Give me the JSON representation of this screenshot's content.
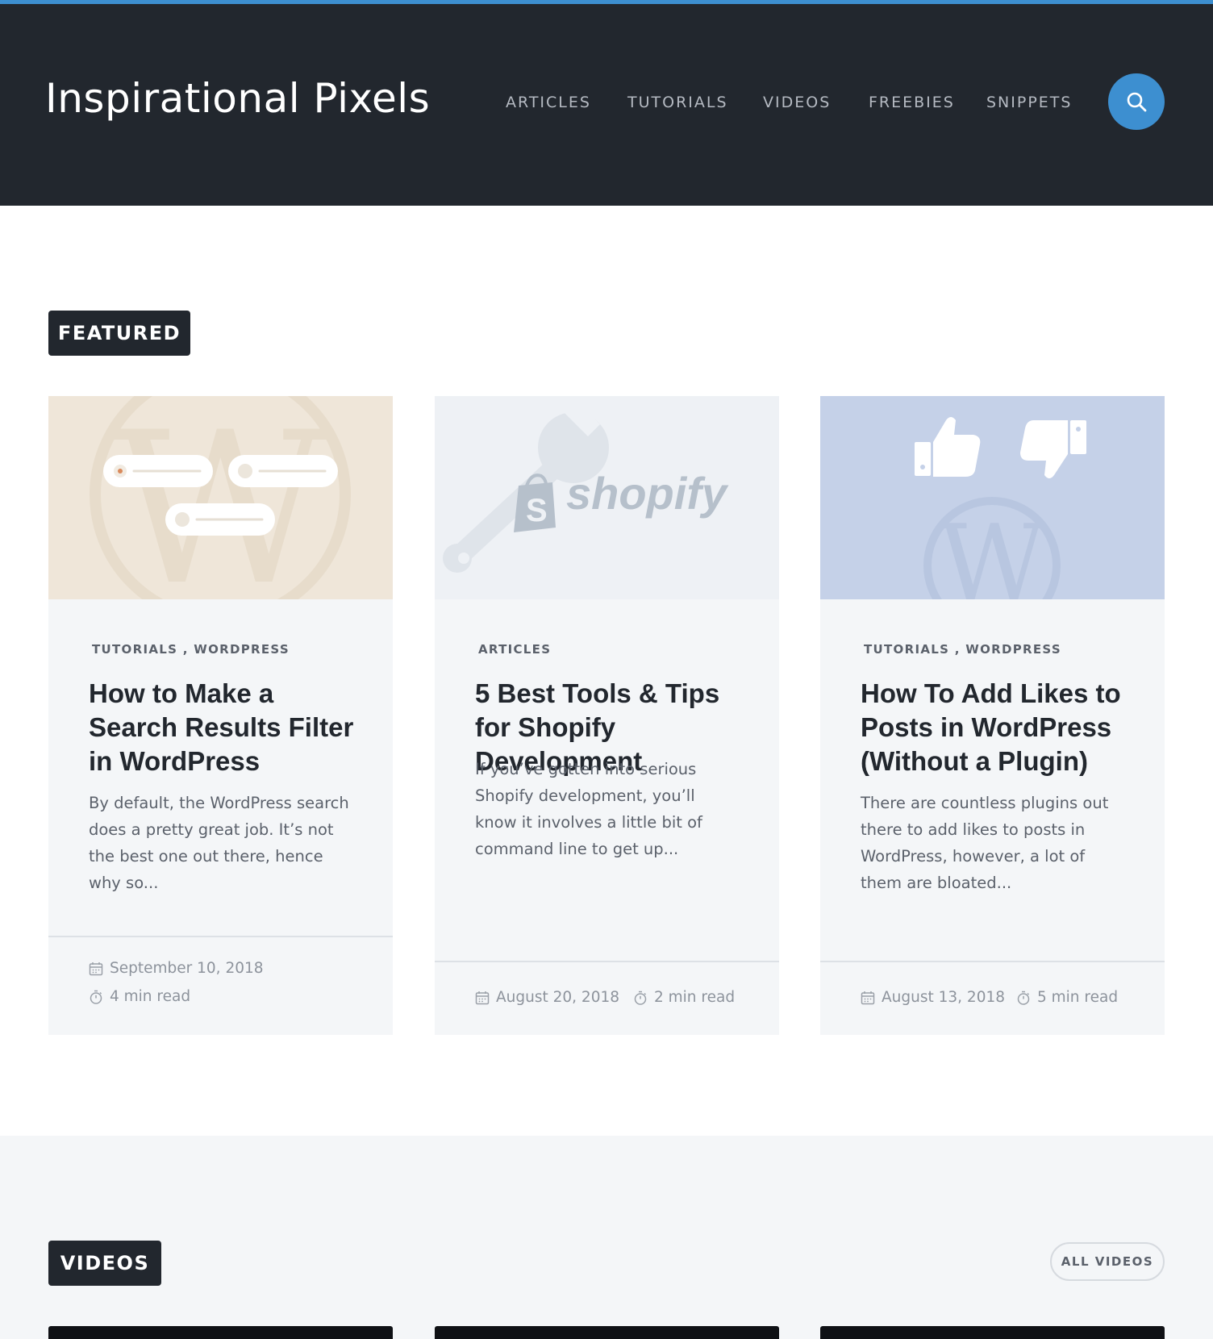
{
  "site": {
    "title": "Inspirational Pixels"
  },
  "nav": {
    "items": [
      {
        "label": "ARTICLES"
      },
      {
        "label": "TUTORIALS"
      },
      {
        "label": "VIDEOS"
      },
      {
        "label": "FREEBIES"
      },
      {
        "label": "SNIPPETS"
      }
    ],
    "search_icon": "search-icon"
  },
  "featured": {
    "label": "FEATURED",
    "cards": [
      {
        "categories": "TUTORIALS ,  WORDPRESS",
        "title": "How to Make a Search Results Filter in WordPress",
        "excerpt": "By default, the WordPress search does a pretty great job. It’s not the best one out there, hence why so...",
        "date": "September 10, 2018",
        "read_time": "4 min read",
        "image": "wordpress-filter-illustration"
      },
      {
        "categories": "ARTICLES",
        "title": "5 Best Tools & Tips for Shopify Development",
        "excerpt": "If you’ve gotten into serious Shopify development, you’ll know it involves a little bit of command line to get up...",
        "date": "August 20, 2018",
        "read_time": "2 min read",
        "image": "shopify-wrench-illustration",
        "image_text": "shopify"
      },
      {
        "categories": "TUTORIALS ,  WORDPRESS",
        "title": "How To Add Likes to Posts in WordPress (Without a Plugin)",
        "excerpt": "There are countless plugins out there to add likes to posts in WordPress, however, a lot of them are bloated...",
        "date": "August 13, 2018",
        "read_time": "5 min read",
        "image": "thumbs-up-down-illustration"
      }
    ]
  },
  "videos": {
    "label": "VIDEOS",
    "all_label": "ALL VIDEOS"
  },
  "colors": {
    "header_bg": "#22272e",
    "accent": "#3d8fd0",
    "card_bg": "#f4f6f8"
  }
}
